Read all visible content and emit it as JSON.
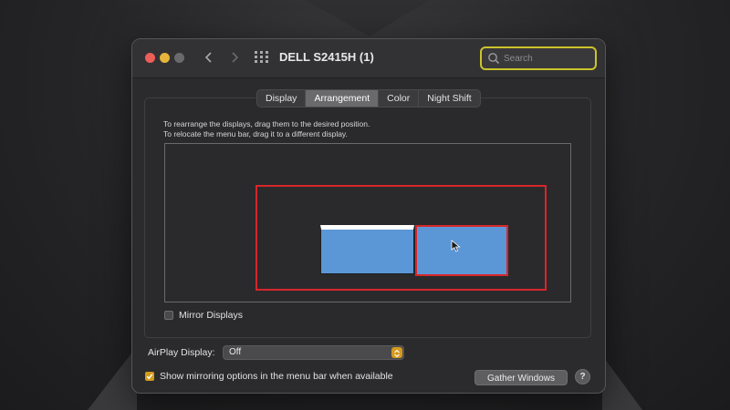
{
  "window": {
    "title": "DELL S2415H (1)",
    "search_placeholder": "Search"
  },
  "tabs": [
    {
      "label": "Display",
      "active": false
    },
    {
      "label": "Arrangement",
      "active": true
    },
    {
      "label": "Color",
      "active": false
    },
    {
      "label": "Night Shift",
      "active": false
    }
  ],
  "arrangement": {
    "instruction_1": "To rearrange the displays, drag them to the desired position.",
    "instruction_2": "To relocate the menu bar, drag it to a different display.",
    "mirror_label": "Mirror Displays",
    "mirror_checked": false
  },
  "airplay": {
    "label": "AirPlay Display:",
    "value": "Off"
  },
  "footer": {
    "show_mirroring_label": "Show mirroring options in the menu bar when available",
    "show_mirroring_checked": true,
    "gather_label": "Gather Windows",
    "help_label": "?"
  },
  "icons": {
    "back": "chevron-left-icon",
    "forward": "chevron-right-icon",
    "grid": "grid-icon",
    "search": "search-icon",
    "cursor": "cursor-icon"
  },
  "colors": {
    "display_blue": "#5b97d6",
    "highlight_red": "#d7262a",
    "search_outline": "#cbc42a",
    "accent_orange": "#d49a1b"
  }
}
